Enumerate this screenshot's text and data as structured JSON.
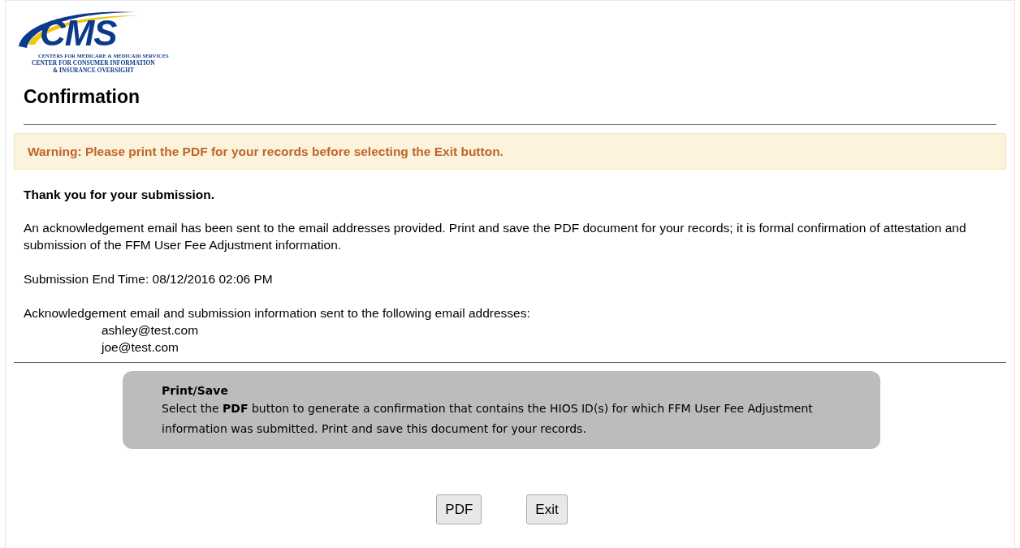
{
  "logo": {
    "mark": "CMS",
    "line_1": "CENTERS FOR MEDICARE & MEDICAID SERVICES",
    "line_2": "CENTER FOR CONSUMER INFORMATION",
    "line_3": "& INSURANCE OVERSIGHT"
  },
  "title": "Confirmation",
  "warning": "Warning: Please print the PDF for your records before selecting the Exit button.",
  "thanks": "Thank you for your submission.",
  "message": "An acknowledgement email has been sent to the email addresses provided. Print and save the PDF document for your records; it is formal confirmation of attestation and submission of the FFM User Fee Adjustment information.",
  "end_time": "Submission End Time: 08/12/2016 02:06 PM",
  "emails_intro": "Acknowledgement email and submission information sent to the following email addresses:",
  "emails": [
    "ashley@test.com",
    "joe@test.com"
  ],
  "info_box": {
    "heading": "Print/Save",
    "text": "Select the **PDF** button to generate a confirmation that contains the HIOS ID(s) for which FFM User Fee Adjustment information was submitted. Print and save this document for your records."
  },
  "buttons": [
    "PDF",
    "Exit"
  ]
}
